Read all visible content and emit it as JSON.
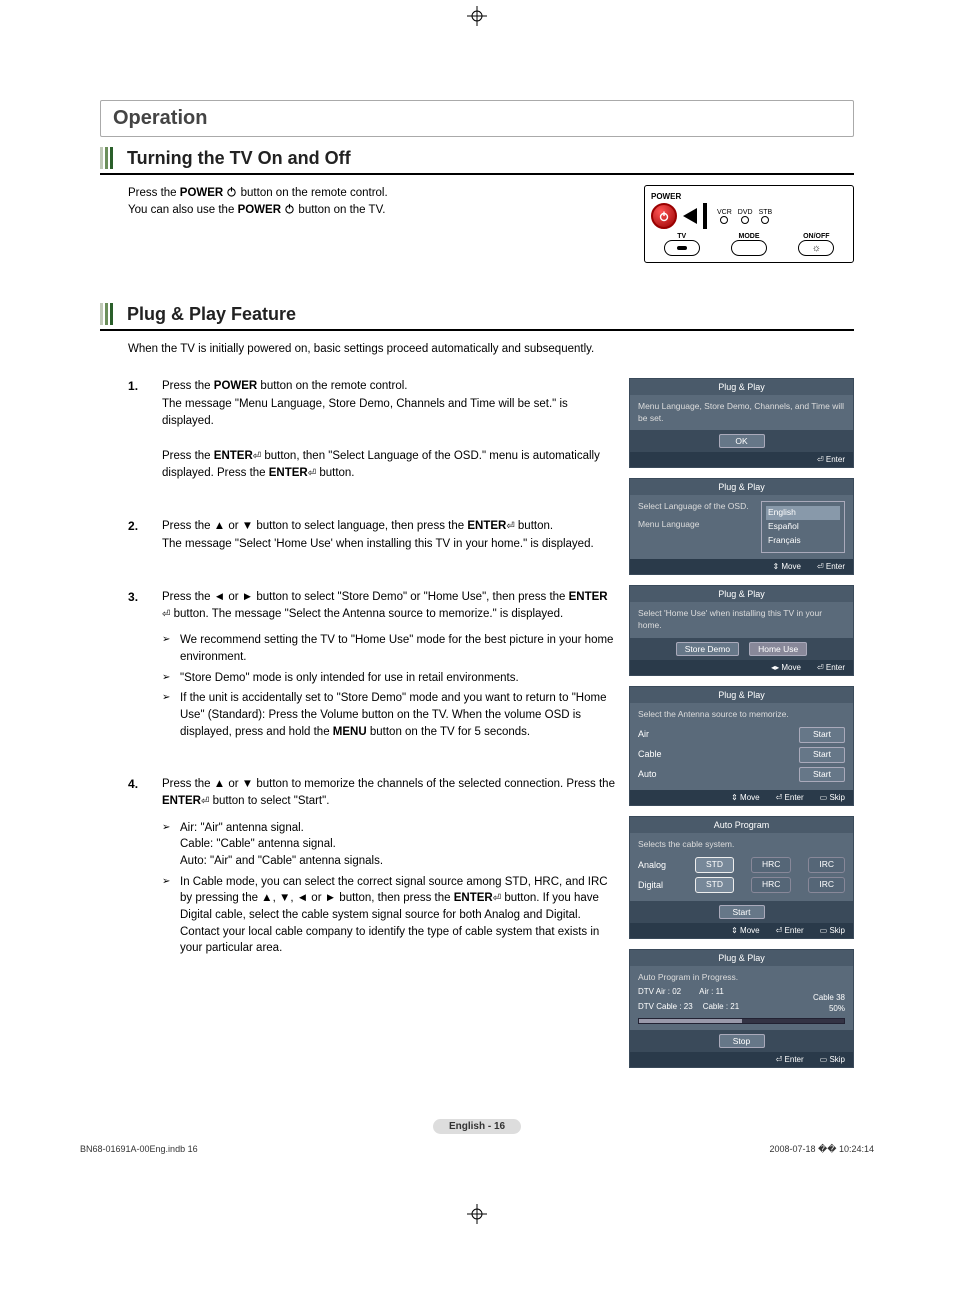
{
  "section_title": "Operation",
  "sub1": {
    "title": "Turning the TV On and Off",
    "line1_pre": "Press the ",
    "line1_bold": "POWER",
    "line1_post": " button on the remote control.",
    "line2_pre": "You can also use the ",
    "line2_bold": "POWER",
    "line2_post": " button on the TV."
  },
  "remote": {
    "power_label": "POWER",
    "tv": "TV",
    "mode": "MODE",
    "onoff": "ON/OFF",
    "vcr": "VCR",
    "dvd": "DVD",
    "stb": "STB"
  },
  "sub2": {
    "title": "Plug & Play Feature",
    "intro": "When the TV is initially powered on, basic settings proceed automatically and subsequently.",
    "steps": [
      {
        "parts": [
          {
            "t": "Press the "
          },
          {
            "b": "POWER"
          },
          {
            "t": " button on the remote control."
          }
        ],
        "extra_lines": [
          "The message \"Menu Language, Store Demo, Channels and Time will be set.\" is displayed.",
          ""
        ],
        "para2": [
          {
            "t": "Press the "
          },
          {
            "b": "ENTER"
          },
          {
            "i": "enter"
          },
          {
            "t": " button, then \"Select Language of the OSD.\" menu is automatically displayed. Press the "
          },
          {
            "b": "ENTER"
          },
          {
            "i": "enter"
          },
          {
            "t": " button."
          }
        ]
      },
      {
        "parts": [
          {
            "t": "Press the ▲ or ▼ button to select language, then press the "
          },
          {
            "b": "ENTER"
          },
          {
            "i": "enter"
          },
          {
            "t": " button."
          }
        ],
        "extra_lines": [
          "The message \"Select 'Home Use' when installing this TV in your home.\" is displayed."
        ]
      },
      {
        "parts": [
          {
            "t": "Press the ◄ or ► button to select \"Store Demo\" or \"Home Use\", then press the "
          },
          {
            "b": "ENTER"
          },
          {
            "i": "enter"
          },
          {
            "t": " button. The message \"Select the Antenna source to memorize.\" is displayed."
          }
        ],
        "notes": [
          "We recommend setting the TV to \"Home Use\" mode for the best picture in your home environment.",
          "\"Store Demo\" mode is only intended for use in retail environments.",
          "If the unit is accidentally set to \"Store Demo\" mode and you want to return to \"Home Use\" (Standard): Press the Volume button on the TV. When the volume OSD is displayed, press and hold the MENU button on the TV for 5 seconds."
        ]
      },
      {
        "parts": [
          {
            "t": "Press the ▲ or ▼ button to memorize the channels of the selected connection. Press the "
          },
          {
            "b": "ENTER"
          },
          {
            "i": "enter"
          },
          {
            "t": " button to select \"Start\"."
          }
        ],
        "notes": [
          "Air: \"Air\" antenna signal.\nCable: \"Cable\" antenna signal.\nAuto: \"Air\" and \"Cable\" antenna signals.",
          "In Cable mode, you can select the correct signal source among STD, HRC, and IRC by pressing the ▲, ▼, ◄ or ► button, then press the ENTER button. If you have Digital cable, select the cable system signal source for both Analog and Digital. Contact your local cable company to identify the type of cable system that exists in your particular area."
        ]
      }
    ]
  },
  "osd1": {
    "title": "Plug & Play",
    "body": "Menu Language, Store Demo, Channels, and Time will be set.",
    "ok": "OK",
    "enter": "Enter"
  },
  "osd2": {
    "title": "Plug & Play",
    "line1": "Select Language of the OSD.",
    "line2": "Menu Language",
    "langs": [
      "English",
      "Español",
      "Français"
    ],
    "move": "Move",
    "enter": "Enter"
  },
  "osd3": {
    "title": "Plug & Play",
    "body": "Select 'Home Use' when installing this TV in your home.",
    "opt1": "Store Demo",
    "opt2": "Home Use",
    "move": "Move",
    "enter": "Enter"
  },
  "osd4": {
    "title": "Plug & Play",
    "body": "Select the Antenna source to memorize.",
    "rows": [
      {
        "label": "Air",
        "btn": "Start"
      },
      {
        "label": "Cable",
        "btn": "Start"
      },
      {
        "label": "Auto",
        "btn": "Start"
      }
    ],
    "move": "Move",
    "enter": "Enter",
    "skip": "Skip"
  },
  "osd5": {
    "title": "Auto Program",
    "body": "Selects the cable system.",
    "rows": [
      {
        "label": "Analog",
        "opts": [
          "STD",
          "HRC",
          "IRC"
        ]
      },
      {
        "label": "Digital",
        "opts": [
          "STD",
          "HRC",
          "IRC"
        ]
      }
    ],
    "start": "Start",
    "move": "Move",
    "enter": "Enter",
    "skip": "Skip"
  },
  "osd6": {
    "title": "Plug & Play",
    "line1": "Auto Program in Progress.",
    "pairs": [
      {
        "l": "DTV Air : 02",
        "r": "Air : 11"
      },
      {
        "l": "DTV Cable : 23",
        "r": "Cable : 21"
      }
    ],
    "right_label": "Cable 38",
    "pct": "50%",
    "stop": "Stop",
    "enter": "Enter",
    "skip": "Skip"
  },
  "page_badge": "English - 16",
  "footer_left": "BN68-01691A-00Eng.indb   16",
  "footer_right": "2008-07-18   �� 10:24:14"
}
